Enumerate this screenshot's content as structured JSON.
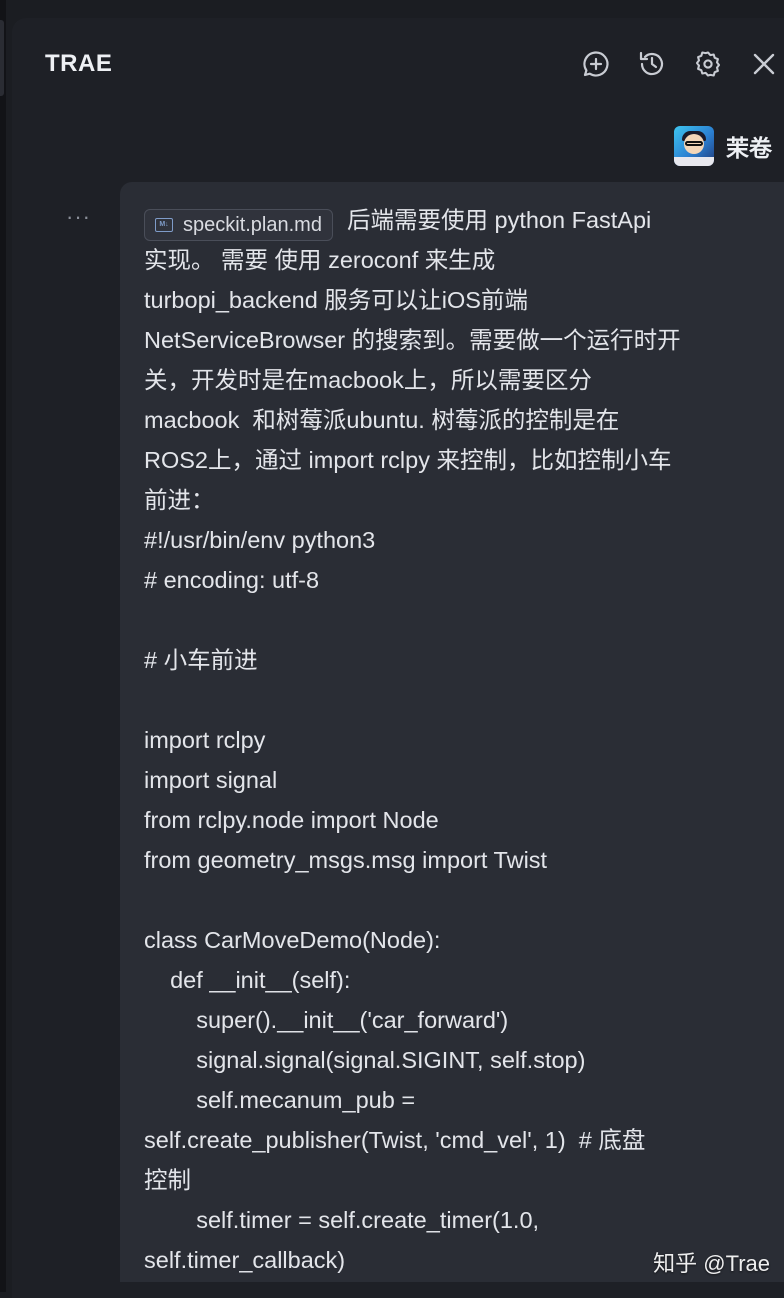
{
  "panel": {
    "title": "TRAE",
    "icons": [
      "new-chat-icon",
      "history-icon",
      "settings-icon",
      "close-icon"
    ]
  },
  "user": {
    "name": "茉卷"
  },
  "message": {
    "more_label": "···",
    "attachment": "speckit.plan.md",
    "first_line_text": "后端需要使用 python FastApi",
    "lines": [
      "实现。 需要 使用 zeroconf 来生成",
      "turbopi_backend 服务可以让iOS前端",
      "NetServiceBrowser 的搜索到。需要做一个运行时开",
      "关，开发时是在macbook上，所以需要区分",
      "macbook  和树莓派ubuntu. 树莓派的控制是在",
      "ROS2上，通过 import rclpy 来控制，比如控制小车",
      "前进：",
      "#!/usr/bin/env python3",
      "# encoding: utf-8",
      "",
      "# 小车前进",
      "",
      "import rclpy",
      "import signal",
      "from rclpy.node import Node",
      "from geometry_msgs.msg import Twist",
      "",
      "class CarMoveDemo(Node):",
      "    def __init__(self):",
      "        super().__init__('car_forward')",
      "        signal.signal(signal.SIGINT, self.stop)",
      "        self.mecanum_pub =",
      "self.create_publisher(Twist, 'cmd_vel', 1)  # 底盘",
      "控制",
      "        self.timer = self.create_timer(1.0,",
      "self.timer_callback)"
    ]
  },
  "watermark": "知乎 @Trae"
}
